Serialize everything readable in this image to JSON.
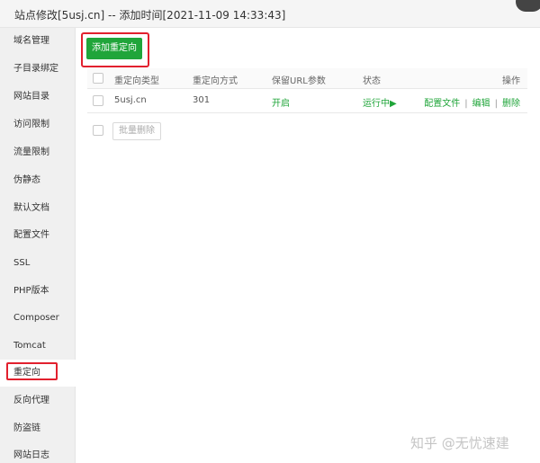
{
  "window": {
    "title": "站点修改[5usj.cn] -- 添加时间[2021-11-09 14:33:43]"
  },
  "sidebar": {
    "items": [
      {
        "label": "域名管理"
      },
      {
        "label": "子目录绑定"
      },
      {
        "label": "网站目录"
      },
      {
        "label": "访问限制"
      },
      {
        "label": "流量限制"
      },
      {
        "label": "伪静态"
      },
      {
        "label": "默认文档"
      },
      {
        "label": "配置文件"
      },
      {
        "label": "SSL"
      },
      {
        "label": "PHP版本"
      },
      {
        "label": "Composer"
      },
      {
        "label": "Tomcat"
      },
      {
        "label": "重定向"
      },
      {
        "label": "反向代理"
      },
      {
        "label": "防盗链"
      },
      {
        "label": "网站日志"
      }
    ],
    "active": "重定向"
  },
  "toolbar": {
    "add_label": "添加重定向"
  },
  "table": {
    "headers": {
      "type": "重定向类型",
      "method": "重定向方式",
      "keep_url": "保留URL参数",
      "status": "状态",
      "ops": "操作"
    },
    "rows": [
      {
        "type": "5usj.cn",
        "method": "301",
        "keep_url": "开启",
        "status": "运行中▶",
        "op_config": "配置文件",
        "op_sep": "|",
        "op_edit": "编辑",
        "op_delete": "删除"
      }
    ]
  },
  "footer": {
    "batch_delete_label": "批量删除"
  },
  "watermark": "知乎 @无忧速建",
  "colors": {
    "accent": "#20a53a",
    "highlight": "#e2202e"
  }
}
